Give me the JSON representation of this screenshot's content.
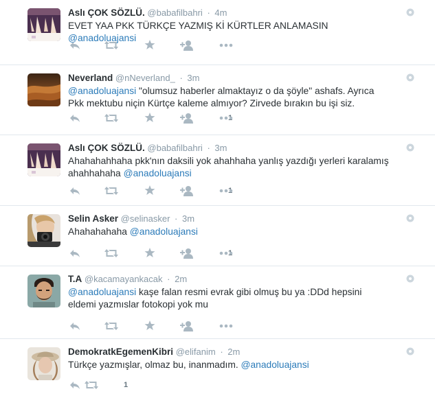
{
  "tweets": [
    {
      "fullname": "Aslı ÇOK SÖZLÜ.",
      "username": "@babafilbahri",
      "time": "4m",
      "text": "EVET YAA PKK TÜRKÇE YAZMIŞ Kİ KÜRTLER ANLAMASIN ",
      "mention_end": "@anadoluajansi",
      "favorites": ""
    },
    {
      "fullname": "Neverland",
      "username": "@nNeverland_",
      "time": "3m",
      "mention_start": "@anadoluajansi",
      "text": " \"olumsuz haberler almaktayız o da şöyle\" ashafs. Ayrıca Pkk mektubu niçin Kürtçe kaleme almıyor? Zirvede bırakın bu işi siz.",
      "favorites": "1"
    },
    {
      "fullname": "Aslı ÇOK SÖZLÜ.",
      "username": "@babafilbahri",
      "time": "3m",
      "text": "Ahahahahhaha pkk'nın daksili yok ahahhaha yanlış yazdığı yerleri karalamış ahahhahaha ",
      "mention_end": "@anadoluajansi",
      "favorites": "1"
    },
    {
      "fullname": "Selin Asker",
      "username": "@selinasker",
      "time": "3m",
      "text": "Ahahahahaha ",
      "mention_end": "@anadoluajansi",
      "favorites": "1"
    },
    {
      "fullname": "T.A",
      "username": "@kacamayankacak",
      "time": "2m",
      "mention_start": "@anadoluajansi",
      "text": " kaşe falan resmi evrak gibi olmuş bu ya :DDd hepsini eldemi yazmıslar fotokopi yok mu",
      "favorites": ""
    },
    {
      "fullname": "DemokratkEgemenKibri",
      "username": "@elifanim",
      "time": "2m",
      "text": "Türkçe yazmışlar, olmaz bu, inanmadım. ",
      "mention_end": "@anadoluajansi",
      "favorites": "1"
    }
  ],
  "colors": {
    "mention": "#2b7bb9",
    "icon": "#aab8c2",
    "border": "#e1e8ed",
    "muted": "#8899a6"
  },
  "icons": [
    "reply-icon",
    "retweet-icon",
    "favorite-icon",
    "follow-icon",
    "more-icon",
    "gear-icon"
  ]
}
